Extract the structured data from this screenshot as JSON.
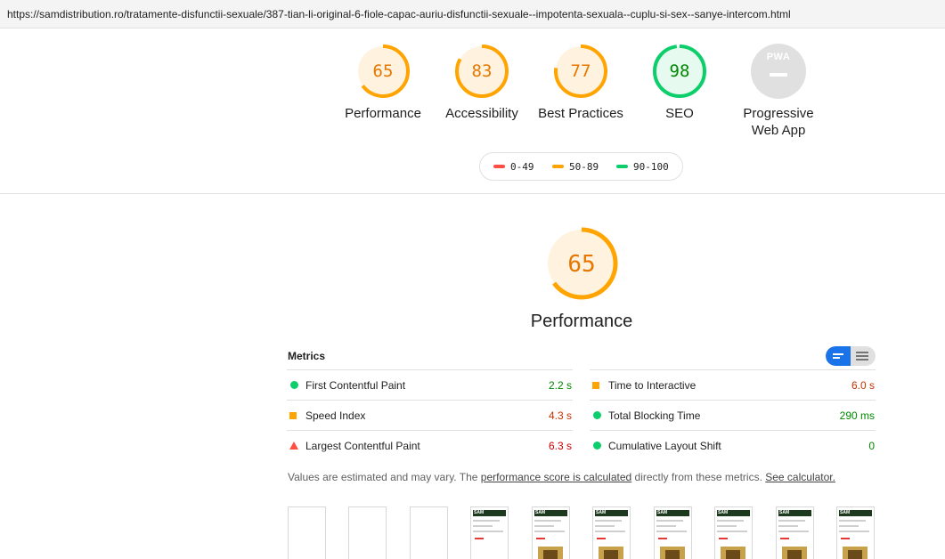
{
  "address_bar": {
    "url": "https://samdistribution.ro/tratamente-disfunctii-sexuale/387-tian-li-original-6-fiole-capac-auriu-disfunctii-sexuale--impotenta-sexuala--cuplu-si-sex--sanye-intercom.html"
  },
  "categories": [
    {
      "score": "65",
      "score_value": 65,
      "label": "Performance",
      "color": "#ffa400"
    },
    {
      "score": "83",
      "score_value": 83,
      "label": "Accessibility",
      "color": "#ffa400"
    },
    {
      "score": "77",
      "score_value": 77,
      "label": "Best Practices",
      "color": "#ffa400"
    },
    {
      "score": "98",
      "score_value": 98,
      "label": "SEO",
      "color": "#0cce6b"
    }
  ],
  "pwa": {
    "badge": "PWA",
    "label_line1": "Progressive",
    "label_line2": "Web App"
  },
  "legend": {
    "poor": {
      "range": "0-49",
      "color": "#ff4e42"
    },
    "average": {
      "range": "50-89",
      "color": "#ffa400"
    },
    "good": {
      "range": "90-100",
      "color": "#0cce6b"
    }
  },
  "performance": {
    "score": "65",
    "score_value": 65,
    "title": "Performance",
    "metrics_header": "Metrics",
    "metrics_left": [
      {
        "name": "First Contentful Paint",
        "value": "2.2 s",
        "rating": "good"
      },
      {
        "name": "Speed Index",
        "value": "4.3 s",
        "rating": "average"
      },
      {
        "name": "Largest Contentful Paint",
        "value": "6.3 s",
        "rating": "poor"
      }
    ],
    "metrics_right": [
      {
        "name": "Time to Interactive",
        "value": "6.0 s",
        "rating": "average"
      },
      {
        "name": "Total Blocking Time",
        "value": "290 ms",
        "rating": "good"
      },
      {
        "name": "Cumulative Layout Shift",
        "value": "0",
        "rating": "good"
      }
    ],
    "note": {
      "prefix": "Values are estimated and may vary. The ",
      "link1": "performance score is calculated",
      "middle": " directly from these metrics. ",
      "link2": "See calculator."
    },
    "thumbnail_logo": "SAM"
  }
}
